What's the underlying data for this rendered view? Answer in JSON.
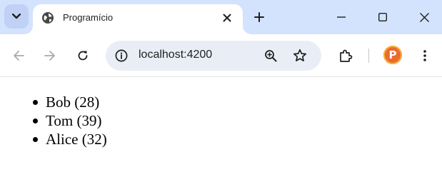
{
  "browser": {
    "tab": {
      "title": "Programício",
      "favicon": "globe-icon"
    },
    "toolbar": {
      "url": "localhost:4200",
      "profile_initial": "P"
    },
    "colors": {
      "tabstrip": "#d3e3fd",
      "omnibox": "#e9eef6",
      "avatar": "#ec6a2f"
    }
  },
  "page": {
    "users": [
      {
        "label": "Bob (28)"
      },
      {
        "label": "Tom (39)"
      },
      {
        "label": "Alice (32)"
      }
    ]
  }
}
